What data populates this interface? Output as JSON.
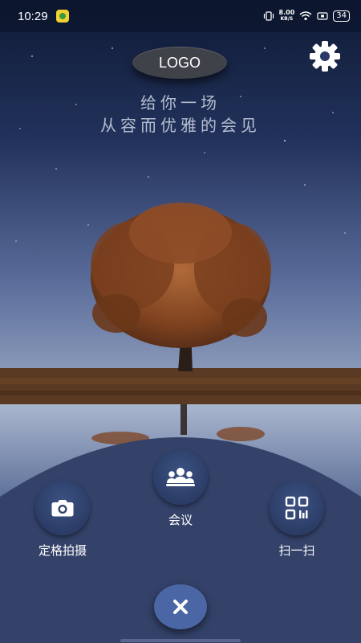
{
  "status_bar": {
    "time": "10:29",
    "net_speed": "8.00",
    "net_unit": "KB/S",
    "battery": "34"
  },
  "header": {
    "logo": "LOGO",
    "tagline_line1": "给你一场",
    "tagline_line2": "从容而优雅的会见",
    "settings_icon": "gear-icon"
  },
  "actions": {
    "camera": {
      "label": "定格拍摄",
      "icon": "camera-icon"
    },
    "meeting": {
      "label": "会议",
      "icon": "people-group-icon"
    },
    "scan": {
      "label": "扫一扫",
      "icon": "qr-scan-icon"
    }
  },
  "close": {
    "icon": "close-icon"
  },
  "colors": {
    "panel": "#34426a",
    "button": "#2b3d66",
    "close_button": "#4a66a4",
    "sky_top": "#0f1a35",
    "sky_bottom": "#8f9fbd",
    "tree_foliage": "#8a4a22"
  }
}
